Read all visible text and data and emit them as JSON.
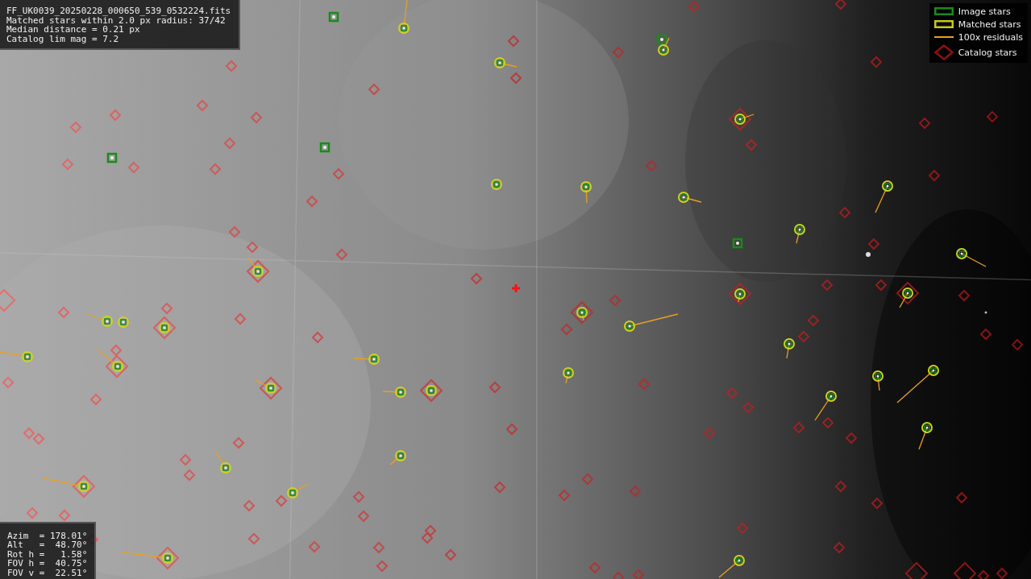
{
  "info_panel": {
    "lines": [
      "FF_UK0039_20250228_000650_539_0532224.fits",
      "Matched stars within 2.0 px radius: 37/42",
      "Median distance = 0.21 px",
      "Catalog lim mag = 7.2"
    ]
  },
  "legend": [
    {
      "label": "Image stars",
      "color": "#1a8a1a"
    },
    {
      "kind": "matched",
      "label": "Matched stars",
      "color": "#c8c81a"
    },
    {
      "kind": "residual",
      "label": "100x residuals",
      "color": "#e8a020"
    },
    {
      "kind": "catalog",
      "label": "Catalog stars",
      "color": "#8b1010"
    }
  ],
  "pointing_panel": {
    "lines": [
      "Azim  = 178.01°",
      "Alt   =  48.70°",
      "Rot h =   1.58°",
      "FOV h =  40.75°",
      "FOV v =  22.51°"
    ]
  }
}
